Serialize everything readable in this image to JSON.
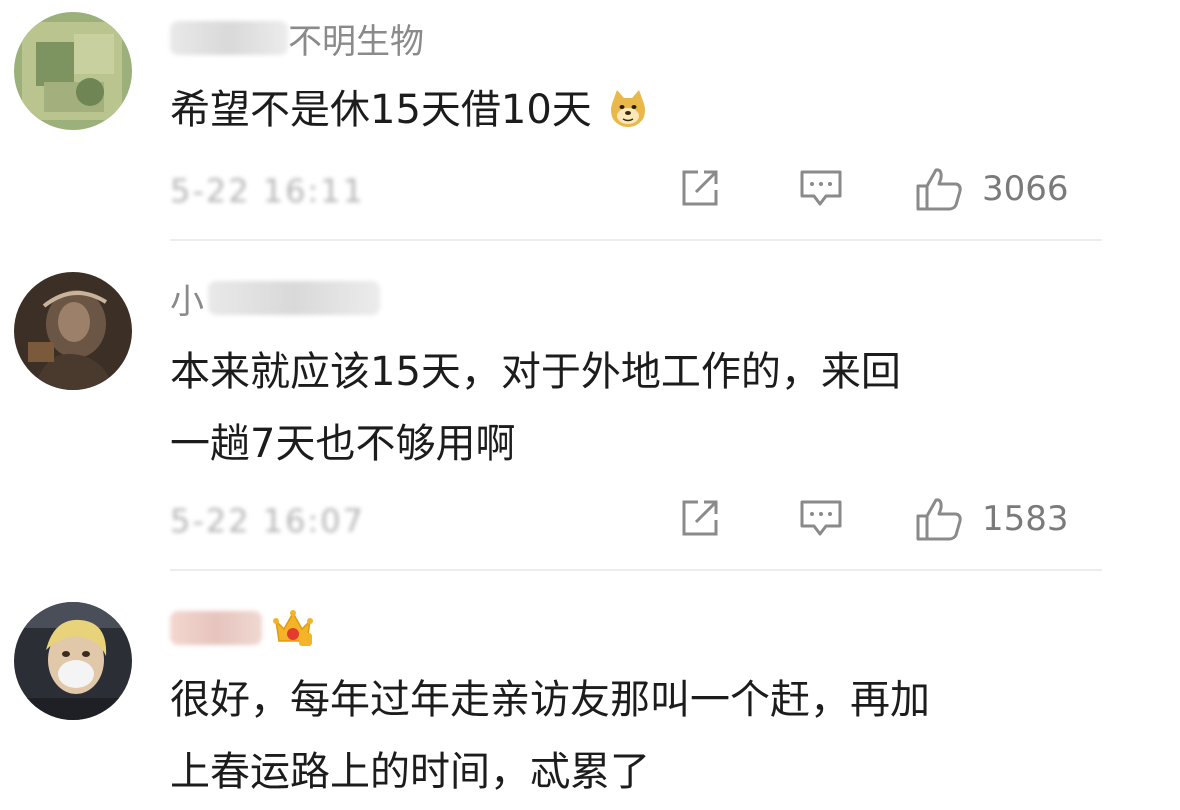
{
  "comments": [
    {
      "username_visible": "不明生物",
      "text": "希望不是休15天借10天",
      "emoji_icon": "doge-emoji-icon",
      "time": "5-22 16:11",
      "likes": "3066"
    },
    {
      "username_visible": "小",
      "text_line1": "本来就应该15天，对于外地工作的，来回",
      "text_line2": "一趟7天也不够用啊",
      "time": "5-22 16:07",
      "likes": "1583"
    },
    {
      "username_visible": "",
      "badge_icon": "crown-badge-icon",
      "text_line1": "很好，每年过年走亲访友那叫一个赶，再加",
      "text_line2": "上春运路上的时间，忒累了"
    }
  ],
  "actions": {
    "share_icon": "share-icon",
    "reply_icon": "comment-icon",
    "like_icon": "thumbs-up-icon"
  },
  "colors": {
    "text": "#1c1c1c",
    "username": "#8a8a8a",
    "meta": "#7a7a7a",
    "divider": "#ededed"
  }
}
